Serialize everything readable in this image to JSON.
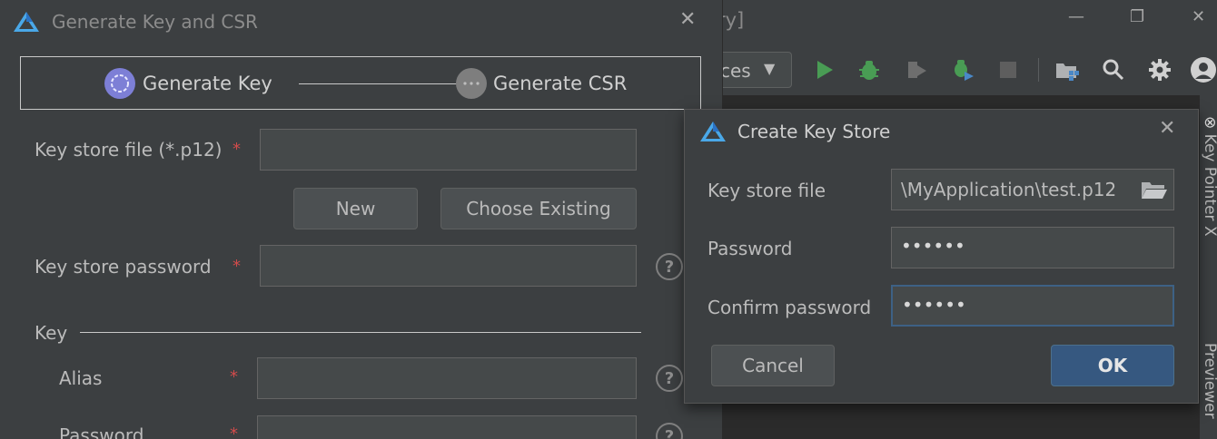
{
  "ide": {
    "title_fragment": "ry]",
    "device_combo_text": "ces",
    "right_tools": [
      "Key Pointer X",
      "Previewer"
    ],
    "colors": {
      "run_green": "#499c54",
      "accent_blue": "#365880"
    }
  },
  "main_dialog": {
    "title": "Generate Key and CSR",
    "steps": [
      {
        "label": "Generate Key",
        "state": "active"
      },
      {
        "label": "Generate CSR",
        "state": "pending"
      }
    ],
    "keystore_file_label": "Key store file (*.p12)",
    "keystore_file_value": "",
    "required_mark": "*",
    "new_button": "New",
    "choose_existing_button": "Choose Existing",
    "keystore_password_label": "Key store password",
    "keystore_password_value": "",
    "key_section_label": "Key",
    "alias_label": "Alias",
    "alias_value": "",
    "password_label": "Password",
    "help_symbol": "?"
  },
  "create_keystore_dialog": {
    "title": "Create Key Store",
    "keystore_file_label": "Key store file",
    "keystore_file_value": "\\MyApplication\\test.p12",
    "password_label": "Password",
    "password_value": "••••••",
    "confirm_password_label": "Confirm password",
    "confirm_password_value": "••••••",
    "cancel_button": "Cancel",
    "ok_button": "OK"
  }
}
